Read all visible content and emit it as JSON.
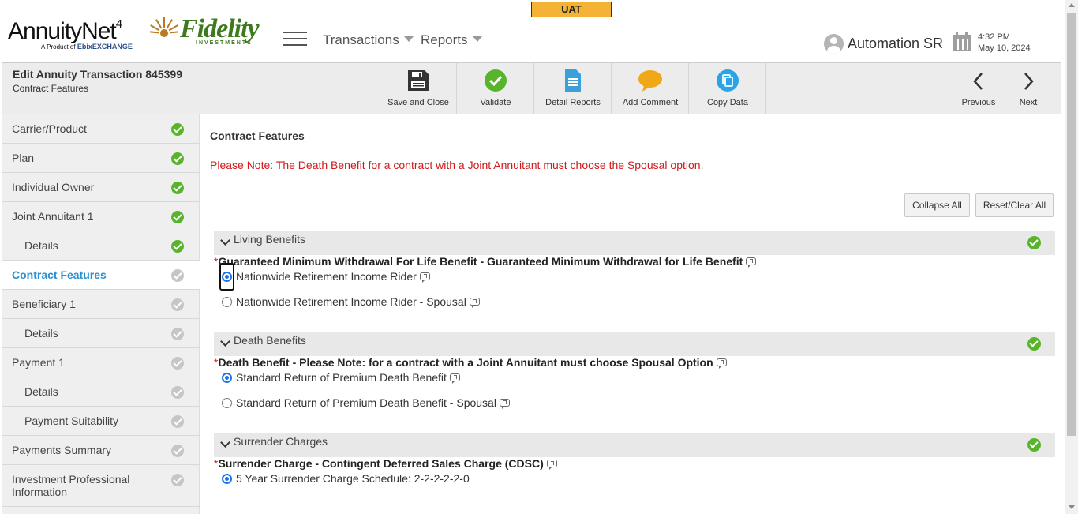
{
  "env_badge": "UAT",
  "brand": {
    "annuity_word": "AnnuityNet",
    "annuity_sup": "4",
    "annuity_tagline_prefix": "A Product of",
    "annuity_tagline_brand": "EbixEXCHANGE",
    "fidelity_word": "Fidelity",
    "fidelity_sub": "INVESTMENTS"
  },
  "topnav": {
    "transactions": "Transactions",
    "reports": "Reports"
  },
  "user": {
    "name": "Automation SR"
  },
  "datetime": {
    "time": "4:32 PM",
    "date": "May 10, 2024"
  },
  "header": {
    "title": "Edit Annuity Transaction 845399",
    "subtitle": "Contract Features"
  },
  "actions": {
    "save_close": "Save and Close",
    "validate": "Validate",
    "detail_reports": "Detail Reports",
    "add_comment": "Add Comment",
    "copy_data": "Copy Data",
    "previous": "Previous",
    "next": "Next"
  },
  "sidebar": {
    "items": [
      {
        "label": "Carrier/Product",
        "status": "complete"
      },
      {
        "label": "Plan",
        "status": "complete"
      },
      {
        "label": "Individual Owner",
        "status": "complete"
      },
      {
        "label": "Joint Annuitant 1",
        "status": "complete"
      },
      {
        "label": "Details",
        "status": "complete"
      },
      {
        "label": "Contract Features",
        "status": "current"
      },
      {
        "label": "Beneficiary 1",
        "status": "pending"
      },
      {
        "label": "Details",
        "status": "pending"
      },
      {
        "label": "Payment 1",
        "status": "pending"
      },
      {
        "label": "Details",
        "status": "pending"
      },
      {
        "label": "Payment Suitability",
        "status": "pending"
      },
      {
        "label": "Payments Summary",
        "status": "pending"
      },
      {
        "label": "Investment Professional Information",
        "status": "pending"
      }
    ]
  },
  "main": {
    "title": "Contract Features",
    "note": "Please Note: The Death Benefit for a contract with a Joint Annuitant must choose the Spousal option.",
    "collapse_all": "Collapse All",
    "reset_clear_all": "Reset/Clear All",
    "sections": [
      {
        "title": "Living Benefits",
        "question": "Guaranteed Minimum Withdrawal For Life Benefit - Guaranteed Minimum Withdrawal for Life Benefit",
        "options": [
          "Nationwide Retirement Income Rider",
          "Nationwide Retirement Income Rider - Spousal"
        ],
        "selected": "Nationwide Retirement Income Rider"
      },
      {
        "title": "Death Benefits",
        "question": "Death Benefit - Please Note: for a contract with a Joint Annuitant must choose Spousal Option",
        "options": [
          "Standard Return of Premium Death Benefit",
          "Standard Return of Premium Death Benefit - Spousal"
        ],
        "selected": "Standard Return of Premium Death Benefit"
      },
      {
        "title": "Surrender Charges",
        "question": "Surrender Charge - Contingent Deferred Sales Charge (CDSC)",
        "options": [
          "5 Year Surrender Charge Schedule: 2-2-2-2-2-0"
        ],
        "selected": "5 Year Surrender Charge Schedule: 2-2-2-2-2-0"
      }
    ]
  },
  "colors": {
    "complete": "#58b42b",
    "pending": "#c6c6c6",
    "active_link": "#2a8fd0",
    "alert": "#d11a1a",
    "uat": "#f5b335"
  }
}
